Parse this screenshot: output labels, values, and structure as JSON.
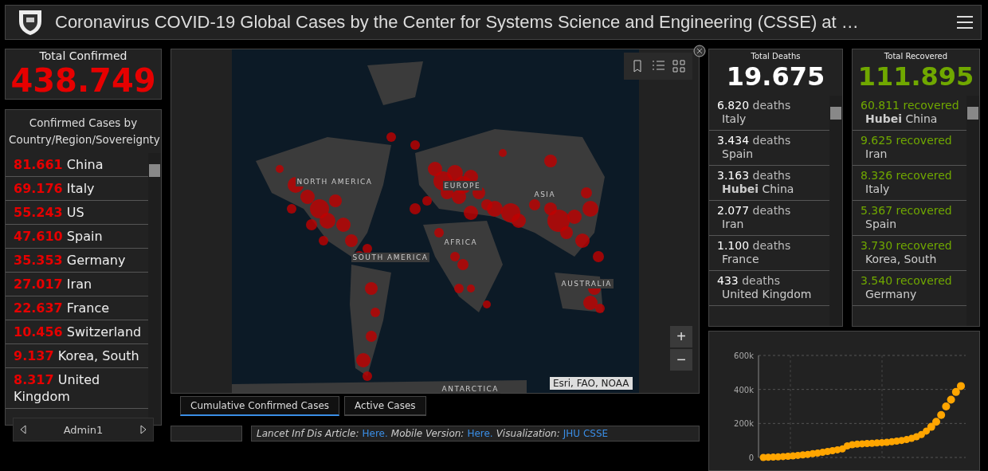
{
  "header": {
    "title": "Coronavirus COVID-19 Global Cases by the Center for Systems Science and Engineering (CSSE) at …"
  },
  "total_confirmed": {
    "label": "Total Confirmed",
    "value": "438.749"
  },
  "confirmed_list": {
    "title": "Confirmed Cases by Country/Region/Sovereignty",
    "rows": [
      {
        "count": "81.661",
        "place": "China"
      },
      {
        "count": "69.176",
        "place": "Italy"
      },
      {
        "count": "55.243",
        "place": "US"
      },
      {
        "count": "47.610",
        "place": "Spain"
      },
      {
        "count": "35.353",
        "place": "Germany"
      },
      {
        "count": "27.017",
        "place": "Iran"
      },
      {
        "count": "22.637",
        "place": "France"
      },
      {
        "count": "10.456",
        "place": "Switzerland"
      },
      {
        "count": "9.137",
        "place": "Korea, South"
      },
      {
        "count": "8.317",
        "place": "United Kingdom"
      }
    ]
  },
  "admin_nav": {
    "label": "Admin1"
  },
  "map": {
    "labels": [
      "NORTH AMERICA",
      "EUROPE",
      "ASIA",
      "AFRICA",
      "SOUTH AMERICA",
      "AUSTRALIA",
      "ANTARCTICA"
    ],
    "attribution": "Esri, FAO, NOAA",
    "zoom_in": "+",
    "zoom_out": "−"
  },
  "map_tabs": [
    {
      "label": "Cumulative Confirmed Cases",
      "selected": true
    },
    {
      "label": "Active Cases",
      "selected": false
    }
  ],
  "info_links": [
    {
      "label": "Lancet Inf Dis Article:",
      "link": "Here."
    },
    {
      "label": "Mobile Version:",
      "link": "Here."
    },
    {
      "label": "Visualization:",
      "link": "JHU CSSE"
    }
  ],
  "total_deaths": {
    "label": "Total Deaths",
    "value": "19.675",
    "rows": [
      {
        "count": "6.820",
        "unit": "deaths",
        "place": "Italy"
      },
      {
        "count": "3.434",
        "unit": "deaths",
        "place": "Spain"
      },
      {
        "count": "3.163",
        "unit": "deaths",
        "place": "**Hubei** China"
      },
      {
        "count": "2.077",
        "unit": "deaths",
        "place": "Iran"
      },
      {
        "count": "1.100",
        "unit": "deaths",
        "place": "France"
      },
      {
        "count": "433",
        "unit": "deaths",
        "place": "United Kingdom"
      }
    ]
  },
  "total_recovered": {
    "label": "Total Recovered",
    "value": "111.895",
    "rows": [
      {
        "count": "60.811",
        "unit": "recovered",
        "place": "**Hubei** China"
      },
      {
        "count": "9.625",
        "unit": "recovered",
        "place": "Iran"
      },
      {
        "count": "8.326",
        "unit": "recovered",
        "place": "Italy"
      },
      {
        "count": "5.367",
        "unit": "recovered",
        "place": "Spain"
      },
      {
        "count": "3.730",
        "unit": "recovered",
        "place": "Korea, South"
      },
      {
        "count": "3.540",
        "unit": "recovered",
        "place": "Germany"
      }
    ]
  },
  "trend_chart": {
    "chart_data": {
      "type": "scatter",
      "grid": true,
      "ylim": [
        0,
        600000
      ],
      "yticks": [
        {
          "value": 0,
          "label": "0"
        },
        {
          "value": 200000,
          "label": "200k"
        },
        {
          "value": 400000,
          "label": "400k"
        },
        {
          "value": 600000,
          "label": "600k"
        }
      ],
      "series": [
        {
          "color": "#ffa500",
          "values": [
            0,
            1000,
            2000,
            3000,
            5000,
            7000,
            9000,
            12000,
            15000,
            18000,
            22000,
            26000,
            30000,
            35000,
            40000,
            45000,
            50000,
            68000,
            75000,
            78000,
            80000,
            82000,
            83000,
            85000,
            87000,
            89000,
            92000,
            96000,
            100000,
            105000,
            112000,
            122000,
            135000,
            155000,
            180000,
            210000,
            250000,
            300000,
            340000,
            385000,
            420000
          ]
        }
      ]
    }
  }
}
